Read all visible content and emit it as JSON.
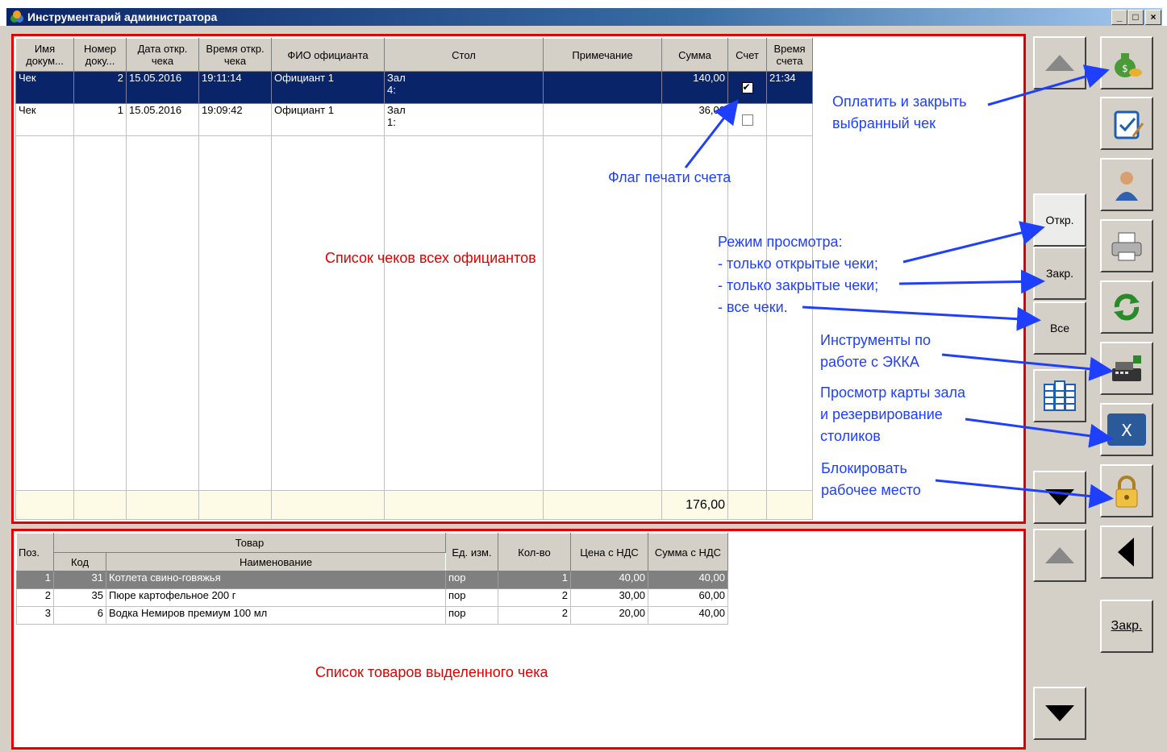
{
  "window": {
    "title": "Инструментарий администратора",
    "btn_min": "_",
    "btn_max": "□",
    "btn_close": "×"
  },
  "checks_table": {
    "headers": [
      "Имя докум...",
      "Номер доку...",
      "Дата откр. чека",
      "Время откр. чека",
      "ФИО официанта",
      "Стол",
      "Примечание",
      "Сумма",
      "Счет",
      "Время счета"
    ],
    "rows": [
      {
        "doc": "Чек",
        "num": "2",
        "date": "15.05.2016",
        "time": "19:11:14",
        "waiter": "Официант 1",
        "table1": "Зал",
        "table2": "4:",
        "note": "",
        "sum": "140,00",
        "bill": true,
        "bill_time": "21:34"
      },
      {
        "doc": "Чек",
        "num": "1",
        "date": "15.05.2016",
        "time": "19:09:42",
        "waiter": "Официант 1",
        "table1": "Зал",
        "table2": "1:",
        "note": "",
        "sum": "36,00",
        "bill": false,
        "bill_time": ""
      }
    ],
    "total": "176,00"
  },
  "items_table": {
    "headers": {
      "pos": "Поз.",
      "goods": "Товар",
      "code": "Код",
      "name": "Наименование",
      "unit": "Ед. изм.",
      "qty": "Кол-во",
      "price": "Цена с НДС",
      "sum": "Сумма с НДС"
    },
    "rows": [
      {
        "pos": "1",
        "code": "31",
        "name": "Котлета свино-говяжья",
        "unit": "пор",
        "qty": "1",
        "price": "40,00",
        "sum": "40,00"
      },
      {
        "pos": "2",
        "code": "35",
        "name": "Пюре картофельное 200 г",
        "unit": "пор",
        "qty": "2",
        "price": "30,00",
        "sum": "60,00"
      },
      {
        "pos": "3",
        "code": "6",
        "name": "Водка Немиров премиум 100 мл",
        "unit": "пор",
        "qty": "2",
        "price": "20,00",
        "sum": "40,00"
      }
    ]
  },
  "mode_buttons": {
    "open": "Откр.",
    "closed": "Закр.",
    "all": "Все"
  },
  "close_button": "Закр.",
  "annotations": {
    "checks_list": "Список чеков всех официантов",
    "items_list": "Список товаров выделенного чека",
    "pay_close_1": "Оплатить и закрыть",
    "pay_close_2": "выбранный чек",
    "bill_flag": "Флаг печати счета",
    "view_mode_1": "Режим просмотра:",
    "view_mode_2": "- только открытые чеки;",
    "view_mode_3": "- только закрытые чеки;",
    "view_mode_4": "- все чеки.",
    "ekka_1": "Инструменты по",
    "ekka_2": "работе с ЭККА",
    "hall_1": "Просмотр карты зала",
    "hall_2": "и резервирование",
    "hall_3": "столиков",
    "lock_1": "Блокировать",
    "lock_2": "рабочее место"
  },
  "colors": {
    "annotation_red": "#e00000",
    "annotation_blue": "#1f3fff",
    "selection": "#0a246a"
  }
}
